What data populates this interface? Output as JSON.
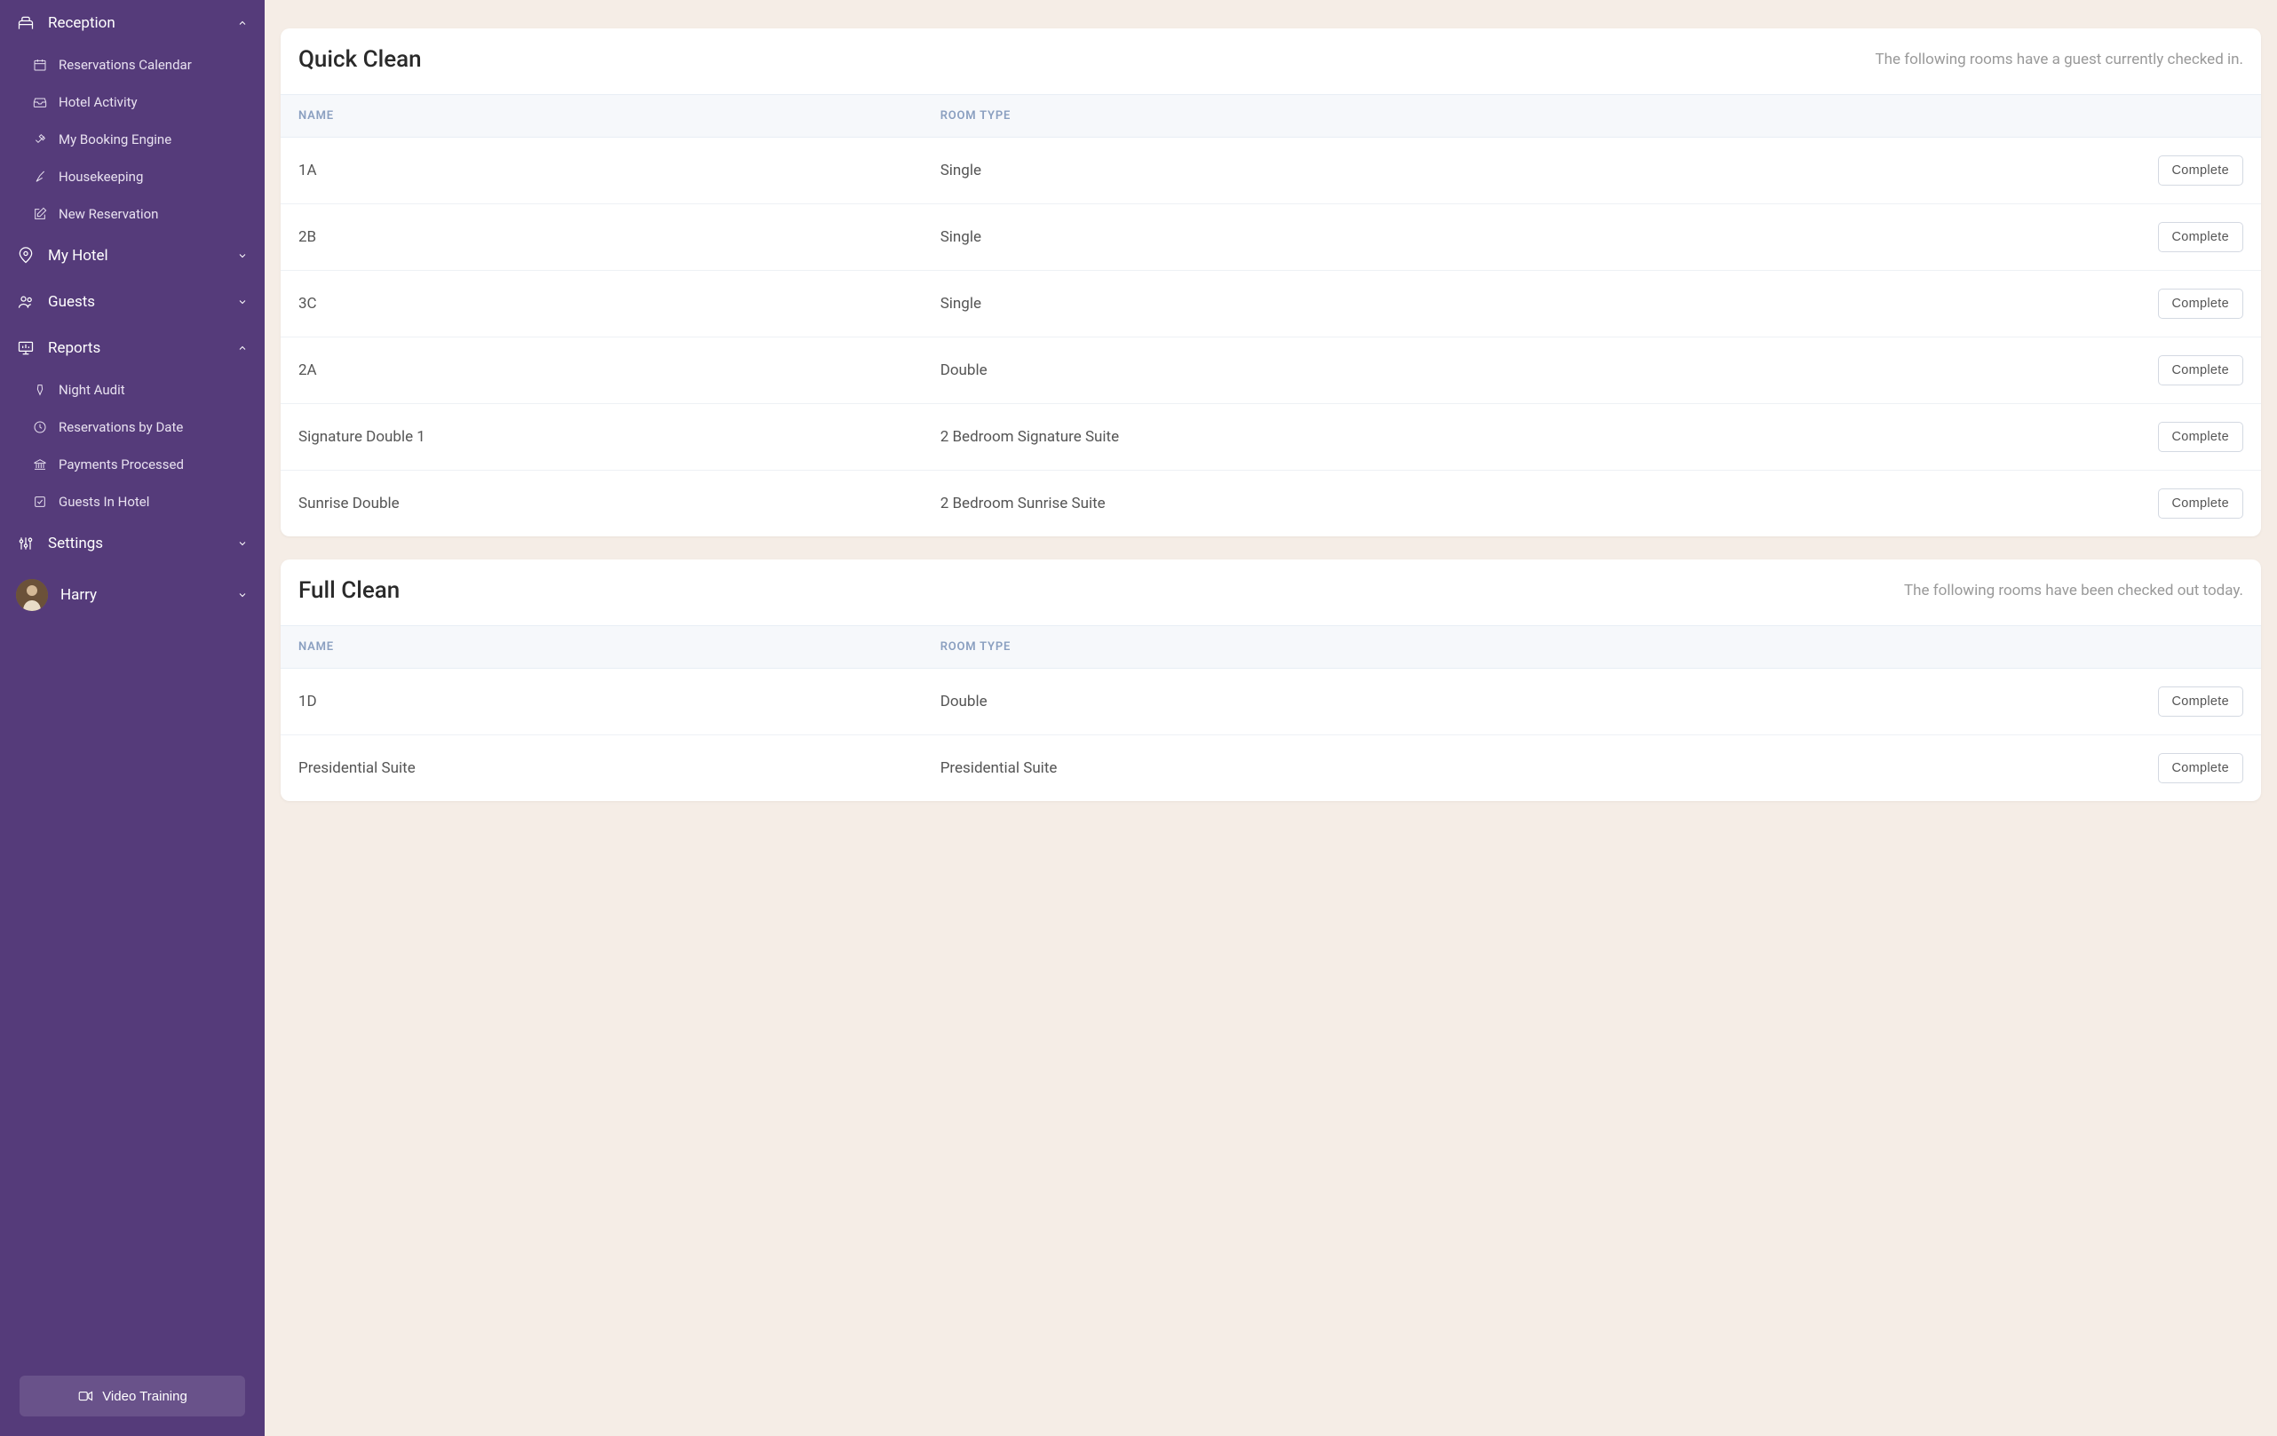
{
  "sidebar": {
    "reception": {
      "label": "Reception",
      "items": [
        {
          "label": "Reservations Calendar"
        },
        {
          "label": "Hotel Activity"
        },
        {
          "label": "My Booking Engine"
        },
        {
          "label": "Housekeeping"
        },
        {
          "label": "New Reservation"
        }
      ]
    },
    "my_hotel": {
      "label": "My Hotel"
    },
    "guests": {
      "label": "Guests"
    },
    "reports": {
      "label": "Reports",
      "items": [
        {
          "label": "Night Audit"
        },
        {
          "label": "Reservations by Date"
        },
        {
          "label": "Payments Processed"
        },
        {
          "label": "Guests In Hotel"
        }
      ]
    },
    "settings": {
      "label": "Settings"
    },
    "user": {
      "name": "Harry"
    },
    "video_training": "Video Training"
  },
  "quick_clean": {
    "title": "Quick Clean",
    "subtitle": "The following rooms have a guest currently checked in.",
    "headers": {
      "name": "NAME",
      "room_type": "ROOM TYPE"
    },
    "button_label": "Complete",
    "rows": [
      {
        "name": "1A",
        "room_type": "Single"
      },
      {
        "name": "2B",
        "room_type": "Single"
      },
      {
        "name": "3C",
        "room_type": "Single"
      },
      {
        "name": "2A",
        "room_type": "Double"
      },
      {
        "name": "Signature Double 1",
        "room_type": "2 Bedroom Signature Suite"
      },
      {
        "name": "Sunrise Double",
        "room_type": "2 Bedroom Sunrise Suite"
      }
    ]
  },
  "full_clean": {
    "title": "Full Clean",
    "subtitle": "The following rooms have been checked out today.",
    "headers": {
      "name": "NAME",
      "room_type": "ROOM TYPE"
    },
    "button_label": "Complete",
    "rows": [
      {
        "name": "1D",
        "room_type": "Double"
      },
      {
        "name": "Presidential Suite",
        "room_type": "Presidential Suite"
      }
    ]
  }
}
